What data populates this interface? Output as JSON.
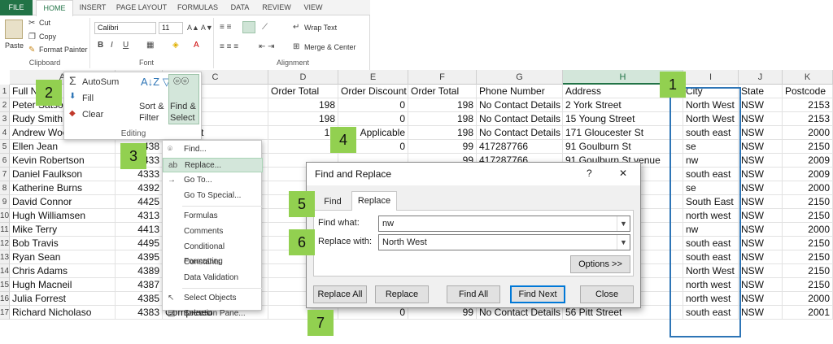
{
  "ribbon": {
    "tabs": [
      "FILE",
      "HOME",
      "INSERT",
      "PAGE LAYOUT",
      "FORMULAS",
      "DATA",
      "REVIEW",
      "VIEW"
    ],
    "active_tab": "HOME",
    "clipboard": {
      "paste": "Paste",
      "cut": "Cut",
      "copy": "Copy",
      "format_painter": "Format Painter",
      "label": "Clipboard"
    },
    "font": {
      "name": "Calibri",
      "size": "11",
      "label": "Font"
    },
    "alignment": {
      "wrap_text": "Wrap Text",
      "merge_center": "Merge & Center",
      "label": "Alignment"
    }
  },
  "editing": {
    "autosum": "AutoSum",
    "fill": "Fill",
    "clear": "Clear",
    "sort_filter_1": "Sort &",
    "sort_filter_2": "Filter",
    "find_select_1": "Find &",
    "find_select_2": "Select",
    "label": "Editing"
  },
  "menu": {
    "items": [
      "Find...",
      "Replace...",
      "Go To...",
      "Go To Special...",
      "Formulas",
      "Comments",
      "Conditional Formatting",
      "Constants",
      "Data Validation",
      "Select Objects",
      "Selection Pane..."
    ]
  },
  "dialog": {
    "title": "Find and Replace",
    "help": "?",
    "close": "✕",
    "tab_find": "Find",
    "tab_replace": "Replace",
    "find_label": "Find what:",
    "find_value": "nw",
    "replace_label": "Replace with:",
    "replace_value": "North West",
    "options": "Options >>",
    "replace_all": "Replace All",
    "replace": "Replace",
    "find_all": "Find All",
    "find_next": "Find Next",
    "close_btn": "Close"
  },
  "callouts": [
    "1",
    "2",
    "3",
    "4",
    "5",
    "6",
    "7"
  ],
  "grid": {
    "columns": [
      "A",
      "",
      "C",
      "D",
      "E",
      "F",
      "G",
      "H",
      "",
      "I",
      "J",
      "K"
    ],
    "headers": {
      "a": "Full N",
      "c": "tatus",
      "d": "Order Total",
      "e": "Order Discount",
      "f": "Order Total",
      "g": "Phone Number",
      "h": "Address",
      "i": "City",
      "j": "State",
      "k": "Postcode"
    },
    "rows": [
      {
        "n": "2",
        "a": "Peter Satso",
        "b": "",
        "c": "ed",
        "d": "198",
        "e": "0",
        "f": "198",
        "g": "No Contact Details",
        "h": "2 York Street",
        "i": "North West",
        "j": "NSW",
        "k": "2153"
      },
      {
        "n": "3",
        "a": "Rudy Smith",
        "b": "",
        "c": "ed",
        "d": "198",
        "e": "0",
        "f": "198",
        "g": "No Contact Details",
        "h": "15 Young Street",
        "i": "North West",
        "j": "NSW",
        "k": "2153"
      },
      {
        "n": "4",
        "a": "Andrew Woo",
        "b": "",
        "c": "Payment",
        "d": "19",
        "e": "Applicable",
        "f": "198",
        "g": "No Contact Details",
        "h": "171 Gloucester St",
        "i": "south east",
        "j": "NSW",
        "k": "2000"
      },
      {
        "n": "5",
        "a": "Ellen Jean",
        "b": "438",
        "c": "",
        "d": "9",
        "e": "0",
        "f": "99",
        "g": "417287766",
        "h": "91 Goulburn St",
        "i": "se",
        "j": "NSW",
        "k": "2150"
      },
      {
        "n": "6",
        "a": "Kevin Robertson",
        "b": "433",
        "c": "",
        "d": "",
        "e": "",
        "f": "99",
        "g": "417287766",
        "h": "91 Goulburn St       venue",
        "i": "nw",
        "j": "NSW",
        "k": "2009"
      },
      {
        "n": "7",
        "a": "Daniel Faulkson",
        "b": "4333",
        "c": "",
        "d": "",
        "e": "",
        "f": "",
        "g": "",
        "h": "",
        "i": "south east",
        "j": "NSW",
        "k": "2009"
      },
      {
        "n": "8",
        "a": "Katherine Burns",
        "b": "4392",
        "c": "",
        "d": "",
        "e": "",
        "f": "",
        "g": "",
        "h": "",
        "i": "se",
        "j": "NSW",
        "k": "2000"
      },
      {
        "n": "9",
        "a": "David Connor",
        "b": "4425",
        "c": "",
        "d": "",
        "e": "",
        "f": "",
        "g": "",
        "h": "",
        "i": "South East",
        "j": "NSW",
        "k": "2150"
      },
      {
        "n": "10",
        "a": "Hugh Williamsen",
        "b": "4313",
        "c": "",
        "d": "",
        "e": "",
        "f": "",
        "g": "",
        "h": "eagh St",
        "i": "north west",
        "j": "NSW",
        "k": "2150"
      },
      {
        "n": "11",
        "a": "Mike Terry",
        "b": "4413",
        "c": "",
        "d": "",
        "e": "",
        "f": "",
        "g": "",
        "h": "a",
        "i": "nw",
        "j": "NSW",
        "k": "2000"
      },
      {
        "n": "12",
        "a": "Bob Travis",
        "b": "4495",
        "c": "",
        "d": "",
        "e": "",
        "f": "",
        "g": "",
        "h": "ue",
        "i": "south east",
        "j": "NSW",
        "k": "2150"
      },
      {
        "n": "13",
        "a": "Ryan Sean",
        "b": "4395",
        "c": "",
        "d": "",
        "e": "",
        "f": "",
        "g": "",
        "h": "e",
        "i": "south east",
        "j": "NSW",
        "k": "2150"
      },
      {
        "n": "14",
        "a": "Chris Adams",
        "b": "4389",
        "c": "",
        "d": "",
        "e": "",
        "f": "",
        "g": "",
        "h": "",
        "i": "North West",
        "j": "NSW",
        "k": "2150"
      },
      {
        "n": "15",
        "a": "Hugh Macneil",
        "b": "4387",
        "c": "",
        "d": "",
        "e": "",
        "f": "",
        "g": "",
        "h": "",
        "i": "north west",
        "j": "NSW",
        "k": "2150"
      },
      {
        "n": "16",
        "a": "Julia Forrest",
        "b": "4385",
        "c": "Completed",
        "d": "",
        "e": "",
        "f": "",
        "g": "",
        "h": "",
        "i": "north west",
        "j": "NSW",
        "k": "2000"
      },
      {
        "n": "17",
        "a": "Richard Nicholaso",
        "b": "4383",
        "c": "Completed",
        "d": "",
        "e": "0",
        "f": "99",
        "g": "No Contact Details",
        "h": "56 Pitt Street",
        "i": "south east",
        "j": "NSW",
        "k": "2001"
      }
    ]
  },
  "colors": {
    "green": "#217346",
    "callout": "#92d050",
    "highlight": "#d3e6da",
    "outline": "#2e75b6"
  }
}
